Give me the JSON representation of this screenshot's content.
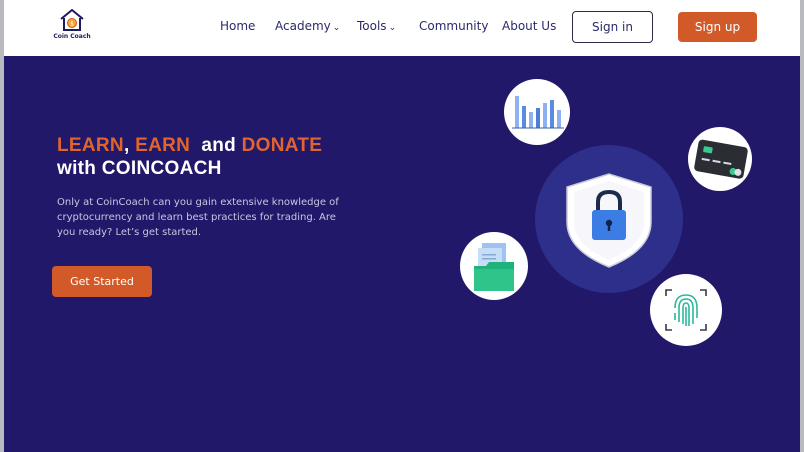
{
  "brand": {
    "name": "Coin Coach"
  },
  "nav": {
    "links": [
      {
        "label": "Home"
      },
      {
        "label": "Academy",
        "dropdown": true
      },
      {
        "label": "Tools",
        "dropdown": true
      },
      {
        "label": "Community"
      },
      {
        "label": "About Us"
      }
    ],
    "signin_label": "Sign in",
    "signup_label": "Sign up"
  },
  "hero": {
    "headline": {
      "word1": "LEARN",
      "sep1": ", ",
      "word2": "EARN",
      "sep2": "  and ",
      "word3": "DONATE",
      "line2": "with COINCOACH"
    },
    "description": "Only at CoinCoach can you gain extensive knowledge of cryptocurrency and learn best practices for trading. Are you ready? Let’s get started.",
    "cta_label": "Get Started"
  },
  "colors": {
    "hero_bg": "#21186a",
    "accent": "#d25a28",
    "headline_accent": "#e0642c",
    "shield_circle": "#2d2f8a"
  },
  "icons": {
    "logo": "house-coin-icon",
    "chevron": "chevron-down-icon",
    "illustration": [
      "bar-chart-icon",
      "credit-card-icon",
      "shield-lock-icon",
      "folder-documents-icon",
      "fingerprint-icon"
    ]
  }
}
